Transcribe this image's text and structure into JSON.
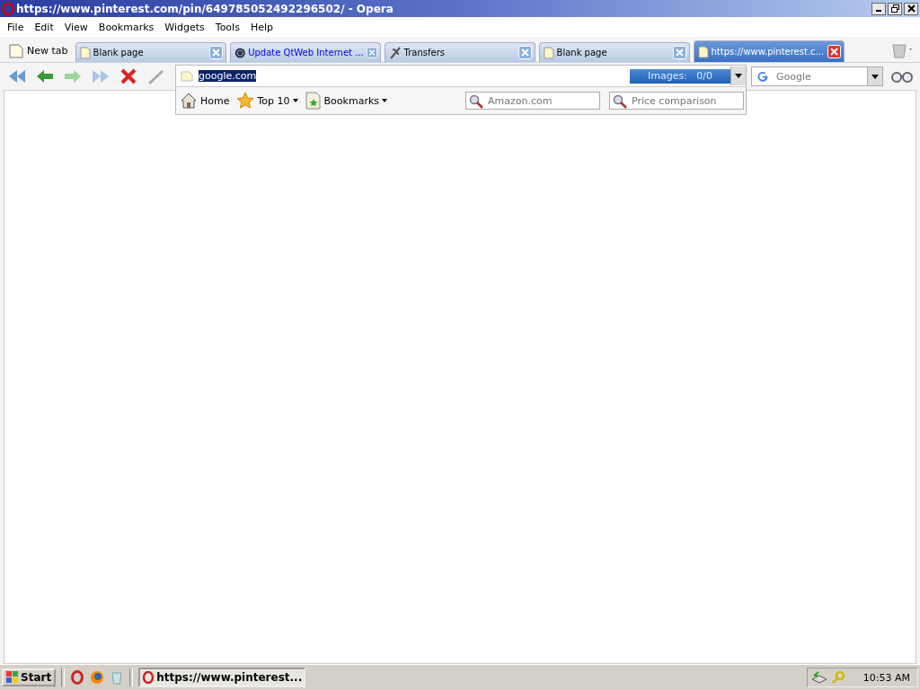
{
  "window": {
    "title": "https://www.pinterest.com/pin/649785052492296502/ - Opera"
  },
  "menu": [
    "File",
    "Edit",
    "View",
    "Bookmarks",
    "Widgets",
    "Tools",
    "Help"
  ],
  "new_tab": "New tab",
  "tabs": [
    {
      "label": "Blank page",
      "kind": "page",
      "selected": false
    },
    {
      "label": "Update QtWeb Internet ...",
      "kind": "update",
      "selected": false
    },
    {
      "label": "Transfers",
      "kind": "transfers",
      "selected": false
    },
    {
      "label": "Blank page",
      "kind": "page",
      "selected": false
    },
    {
      "label": "https://www.pinterest.c...",
      "kind": "page",
      "selected": true
    }
  ],
  "address": {
    "value": "google.com",
    "images_label": "Images:",
    "images_count": "0/0",
    "level": 1
  },
  "quick_links": [
    {
      "label": "Home",
      "kind": "home",
      "menu": false
    },
    {
      "label": "Top 10",
      "kind": "top",
      "menu": true
    },
    {
      "label": "Bookmarks",
      "kind": "bookmarks",
      "menu": true
    }
  ],
  "quick_searches": [
    {
      "placeholder": "Amazon.com"
    },
    {
      "placeholder": "Price comparison"
    }
  ],
  "search": {
    "engine": "Google"
  },
  "taskbar": {
    "start": "Start",
    "task": "https://www.pinterest...",
    "clock": "10:53 AM"
  }
}
